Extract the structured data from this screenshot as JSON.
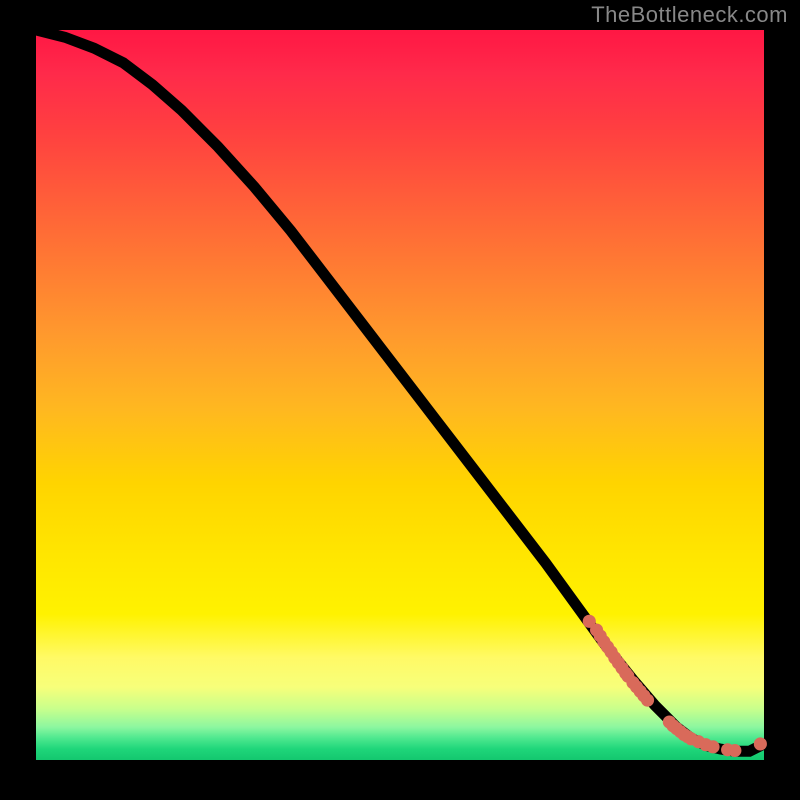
{
  "watermark": "TheBottleneck.com",
  "chart_data": {
    "type": "line",
    "title": "",
    "xlabel": "",
    "ylabel": "",
    "xlim": [
      0,
      100
    ],
    "ylim": [
      0,
      100
    ],
    "grid": false,
    "legend": false,
    "series": [
      {
        "name": "curve",
        "x": [
          0,
          4,
          8,
          12,
          16,
          20,
          25,
          30,
          35,
          40,
          45,
          50,
          55,
          60,
          65,
          70,
          74,
          78,
          82,
          85,
          88,
          90,
          92,
          94,
          96,
          98,
          100
        ],
        "y": [
          100,
          99,
          97.5,
          95.5,
          92.5,
          89,
          84,
          78.5,
          72.5,
          66,
          59.5,
          53,
          46.5,
          40,
          33.5,
          27,
          21.5,
          16,
          11,
          7.5,
          4.5,
          3,
          2,
          1.5,
          1.2,
          1.2,
          2.2
        ]
      }
    ],
    "scatter_points": {
      "name": "markers",
      "x": [
        76,
        77,
        77.5,
        78,
        78.5,
        79,
        79.5,
        80,
        80.5,
        81,
        81.3,
        82,
        82.5,
        83,
        83.5,
        84,
        87,
        87.5,
        88,
        88.5,
        89,
        89.5,
        90,
        91,
        92,
        93,
        95,
        96,
        99.5
      ],
      "y": [
        19,
        17.8,
        17,
        16.2,
        15.5,
        14.8,
        14,
        13.3,
        12.6,
        11.9,
        11.5,
        10.6,
        10,
        9.4,
        8.8,
        8.2,
        5.2,
        4.7,
        4.3,
        3.9,
        3.5,
        3.2,
        2.9,
        2.5,
        2.1,
        1.8,
        1.4,
        1.3,
        2.2
      ]
    },
    "background_gradient": {
      "top": "#ff1744",
      "mid": "#ffe600",
      "bottom": "#14c76f"
    }
  }
}
